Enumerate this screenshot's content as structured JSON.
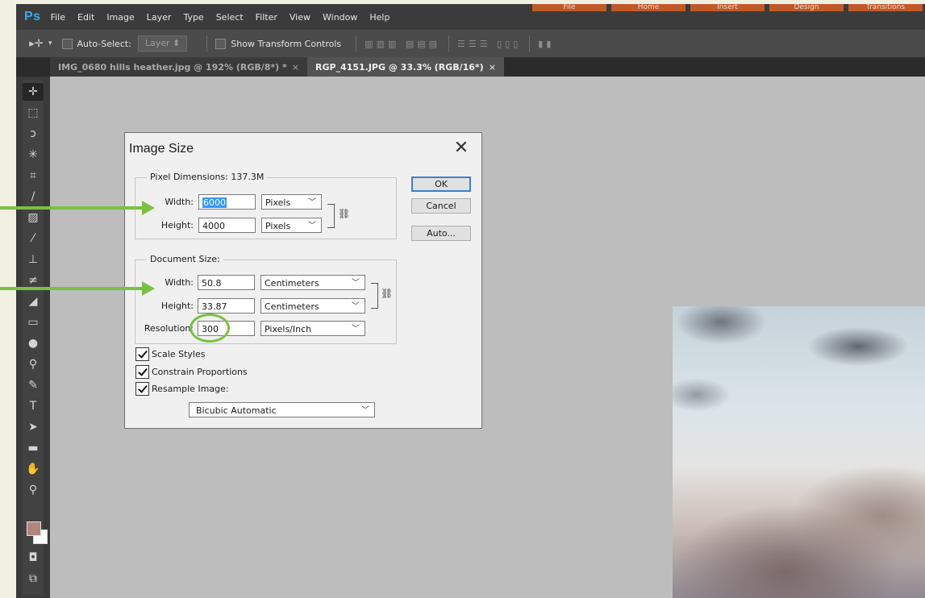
{
  "app": {
    "logo": "Ps"
  },
  "menu": [
    "File",
    "Edit",
    "Image",
    "Layer",
    "Type",
    "Select",
    "Filter",
    "View",
    "Window",
    "Help"
  ],
  "office_tabs": [
    "File",
    "Home",
    "Insert",
    "Design",
    "Transitions"
  ],
  "options_bar": {
    "auto_select_label": "Auto-Select:",
    "auto_select_value": "Layer",
    "show_transform_label": "Show Transform Controls"
  },
  "doc_tabs": [
    {
      "label": "IMG_0680 hills heather.jpg @ 192% (RGB/8*) *",
      "active": false
    },
    {
      "label": "RGP_4151.JPG @ 33.3% (RGB/16*)",
      "active": true
    }
  ],
  "tab_close_glyph": "×",
  "dialog": {
    "title": "Image Size",
    "close_glyph": "✕",
    "pixel_dimensions": {
      "legend": "Pixel Dimensions:  137.3M",
      "width_label": "Width:",
      "width_value": "6000",
      "width_unit": "Pixels",
      "height_label": "Height:",
      "height_value": "4000",
      "height_unit": "Pixels"
    },
    "document_size": {
      "legend": "Document Size:",
      "width_label": "Width:",
      "width_value": "50.8",
      "width_unit": "Centimeters",
      "height_label": "Height:",
      "height_value": "33.87",
      "height_unit": "Centimeters",
      "resolution_label": "Resolution:",
      "resolution_value": "300",
      "resolution_unit": "Pixels/Inch"
    },
    "buttons": {
      "ok": "OK",
      "cancel": "Cancel",
      "auto": "Auto..."
    },
    "checkboxes": [
      {
        "label": "Scale Styles",
        "checked": true
      },
      {
        "label": "Constrain Proportions",
        "checked": true
      },
      {
        "label": "Resample Image:",
        "checked": true
      }
    ],
    "resample_method": "Bicubic Automatic"
  },
  "colors": {
    "annotation_green": "#7ac143",
    "foreground_swatch": "#b0867c",
    "background_swatch": "#ffffff",
    "ps_logo": "#3ea6f2"
  }
}
